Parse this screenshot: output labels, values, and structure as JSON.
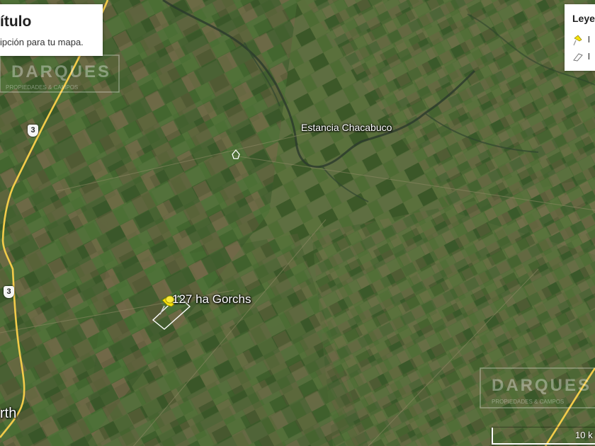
{
  "map_type": "satellite",
  "info_card": {
    "title": "ítulo",
    "description": "ipción para tu mapa."
  },
  "legend": {
    "title": "Leye",
    "items": [
      {
        "icon": "yellow-pushpin-icon",
        "label": "I"
      },
      {
        "icon": "polygon-outline-icon",
        "label": "I"
      }
    ]
  },
  "places": {
    "estancia": "Estancia Chacabuco",
    "parcel": "127 ha Gorchs",
    "town_partial": "rth"
  },
  "route_shields": [
    "3",
    "3"
  ],
  "watermarks": {
    "top_left": {
      "name": "DARQUES",
      "tagline": "PROPIEDADES & CAMPOS"
    },
    "bottom_right": {
      "name": "DARQUES",
      "tagline": "PROPIEDADES & CAMPOS"
    }
  },
  "scale": {
    "label": "10 k"
  },
  "colors": {
    "road": "#f2cb4a",
    "pin": "#f5e20c",
    "river": "#2a3a2c"
  }
}
